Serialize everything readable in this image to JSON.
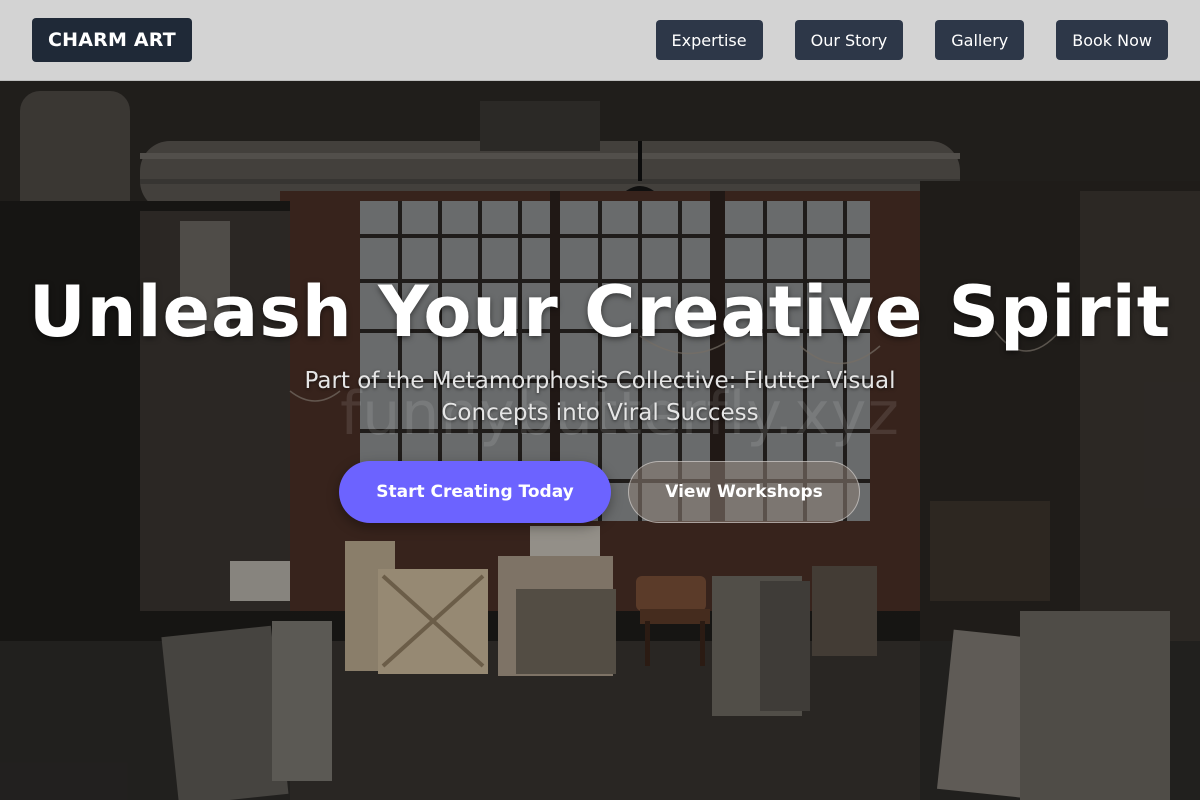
{
  "header": {
    "logo": "CHARM ART",
    "nav": [
      {
        "label": "Expertise"
      },
      {
        "label": "Our Story"
      },
      {
        "label": "Gallery"
      },
      {
        "label": "Book Now"
      }
    ]
  },
  "hero": {
    "title": "Unleash Your Creative Spirit",
    "subtitle": "Part of the Metamorphosis Collective: Flutter Visual Concepts into Viral Success",
    "watermark": "funnybutterfly.xyz",
    "primary_cta": "Start Creating Today",
    "secondary_cta": "View Workshops"
  },
  "colors": {
    "header_bg": "#d3d3d3",
    "logo_bg": "#1f2937",
    "nav_bg": "#2d3748",
    "primary_cta": "#6c63ff"
  }
}
